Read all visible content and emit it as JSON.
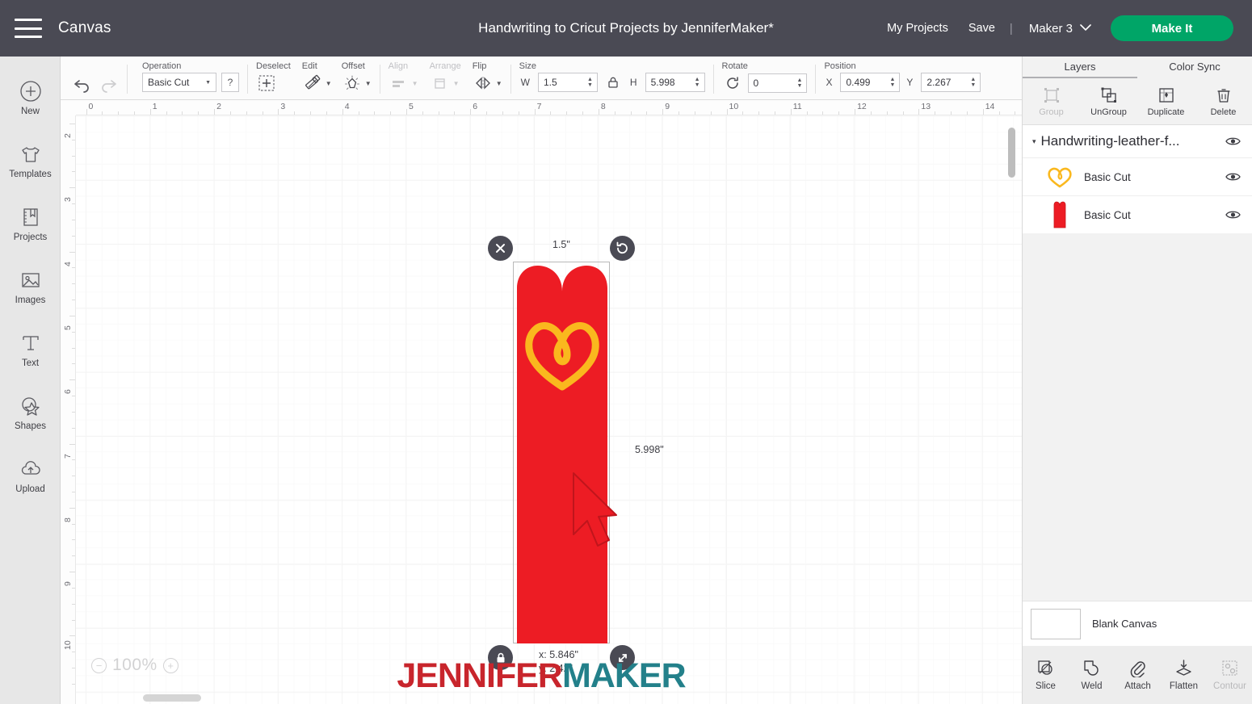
{
  "header": {
    "menu_icon": "hamburger-icon",
    "canvas_label": "Canvas",
    "project_title": "Handwriting to Cricut Projects by JenniferMaker*",
    "my_projects": "My Projects",
    "save": "Save",
    "divider": "|",
    "machine": "Maker 3",
    "make_it": "Make It",
    "bg_color": "#4a4a54",
    "accent_green": "#00a567"
  },
  "left_rail": {
    "items": [
      {
        "label": "New",
        "icon": "plus-circle-icon"
      },
      {
        "label": "Templates",
        "icon": "tshirt-icon"
      },
      {
        "label": "Projects",
        "icon": "book-bookmark-icon"
      },
      {
        "label": "Images",
        "icon": "picture-icon"
      },
      {
        "label": "Text",
        "icon": "text-t-icon"
      },
      {
        "label": "Shapes",
        "icon": "star-circle-icon"
      },
      {
        "label": "Upload",
        "icon": "cloud-upload-icon"
      }
    ]
  },
  "toolbar": {
    "undo_icon": "undo-arrow-icon",
    "redo_icon": "redo-arrow-icon",
    "operation_label": "Operation",
    "operation_value": "Basic Cut",
    "help_label": "?",
    "deselect_label": "Deselect",
    "edit_label": "Edit",
    "offset_label": "Offset",
    "align_label": "Align",
    "arrange_label": "Arrange",
    "flip_label": "Flip",
    "size_label": "Size",
    "width_axis": "W",
    "width_value": "1.5",
    "height_axis": "H",
    "height_value": "5.998",
    "lock_icon": "lock-aspect-icon",
    "rotate_label": "Rotate",
    "rotate_value": "0",
    "position_label": "Position",
    "x_axis": "X",
    "x_value": "0.499",
    "y_axis": "Y",
    "y_value": "2.267"
  },
  "canvas": {
    "ruler_top": [
      "0",
      "1",
      "2",
      "3",
      "4",
      "5",
      "6",
      "7",
      "8",
      "9",
      "10",
      "11",
      "12",
      "13",
      "14"
    ],
    "ruler_left": [
      "2",
      "3",
      "4",
      "5",
      "6",
      "7",
      "8",
      "9",
      "10"
    ],
    "zoom_level": "100%",
    "zoom_out": "−",
    "zoom_in": "+",
    "selection": {
      "width_label": "1.5\"",
      "height_label": "5.998\"",
      "x_label": "x: 5.846\"",
      "y_label": "y: 2.42\"",
      "delete_icon": "close-x-icon",
      "rotate_icon": "rotate-icon",
      "lock_icon": "lock-closed-icon",
      "resize_icon": "resize-diagonal-icon"
    },
    "artwork": {
      "body_color": "#ed1c24",
      "heart_color": "#fab81e",
      "description": "red leather bookmark with heart top and gold handwritten heart doodle"
    },
    "watermark": {
      "part_a": "JENNIFER",
      "part_b": "MAKER",
      "color_a": "#c8252c",
      "color_b": "#23808a"
    }
  },
  "right_panel": {
    "tabs": [
      {
        "label": "Layers",
        "active": true
      },
      {
        "label": "Color Sync",
        "active": false
      }
    ],
    "actions": [
      {
        "label": "Group",
        "icon": "group-icon",
        "disabled": true
      },
      {
        "label": "UnGroup",
        "icon": "ungroup-icon",
        "disabled": false
      },
      {
        "label": "Duplicate",
        "icon": "duplicate-icon",
        "disabled": false
      },
      {
        "label": "Delete",
        "icon": "trash-icon",
        "disabled": false
      }
    ],
    "group": {
      "caret": "▾",
      "name": "Handwriting-leather-f...",
      "visibility_icon": "eye-icon"
    },
    "layers": [
      {
        "name": "Basic Cut",
        "swatch": "heart-outline-gold",
        "color": "#fab81e",
        "visibility_icon": "eye-icon"
      },
      {
        "name": "Basic Cut",
        "swatch": "bookmark-red",
        "color": "#ed1c24",
        "visibility_icon": "eye-icon"
      }
    ],
    "canvas_type": {
      "label": "Blank Canvas",
      "swatch_color": "#ffffff"
    },
    "bottom_tools": [
      {
        "label": "Slice",
        "icon": "slice-icon",
        "disabled": false
      },
      {
        "label": "Weld",
        "icon": "weld-icon",
        "disabled": false
      },
      {
        "label": "Attach",
        "icon": "paperclip-icon",
        "disabled": false
      },
      {
        "label": "Flatten",
        "icon": "flatten-icon",
        "disabled": false
      },
      {
        "label": "Contour",
        "icon": "contour-icon",
        "disabled": true
      }
    ]
  }
}
